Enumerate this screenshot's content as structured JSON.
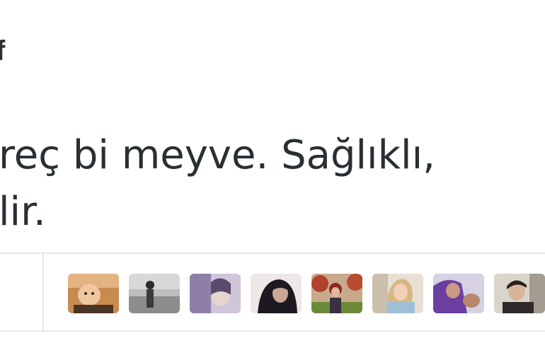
{
  "tweet": {
    "author_fragment": "f",
    "lines": [
      "reç bi meyve. Sağlıklı,",
      "lir."
    ]
  },
  "likers": [
    {
      "icon": "liker-avatar-baby"
    },
    {
      "icon": "liker-avatar-grayscale-person"
    },
    {
      "icon": "liker-avatar-purple-portrait"
    },
    {
      "icon": "liker-avatar-hooded-woman"
    },
    {
      "icon": "liker-avatar-red-hair-outdoor"
    },
    {
      "icon": "liker-avatar-blonde-woman"
    },
    {
      "icon": "liker-avatar-purple-hoodie"
    },
    {
      "icon": "liker-avatar-man-dark-hair"
    }
  ],
  "colors": {
    "text": "#292f33",
    "divider": "#e1e8ed"
  }
}
